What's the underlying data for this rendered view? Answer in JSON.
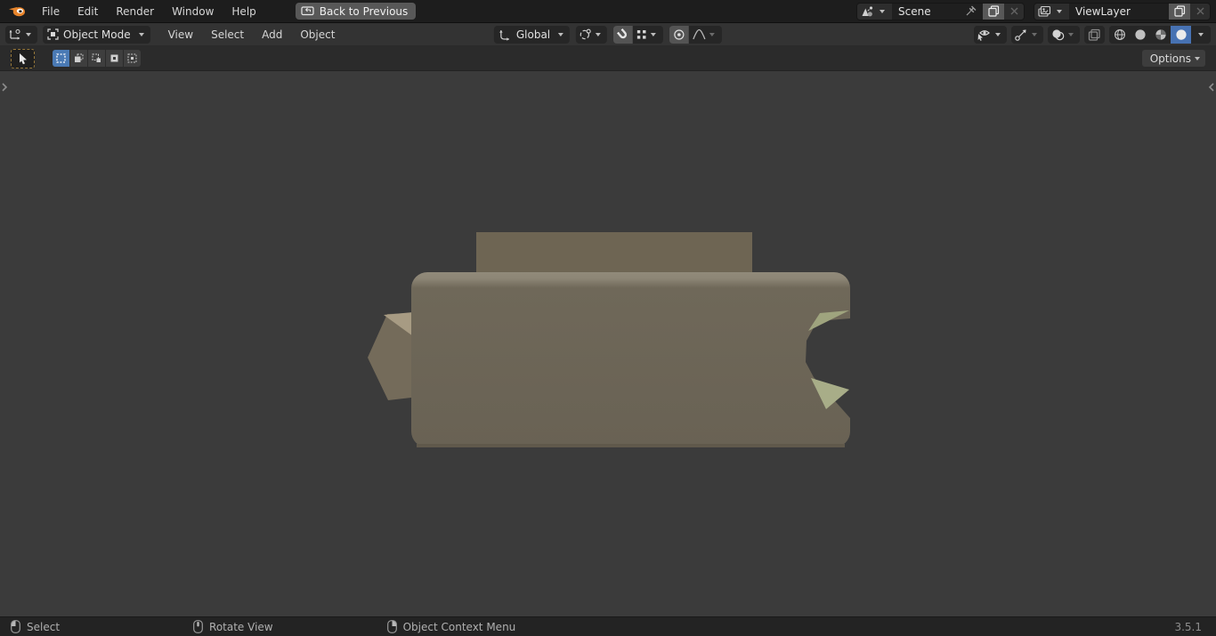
{
  "topbar": {
    "menus": [
      "File",
      "Edit",
      "Render",
      "Window",
      "Help"
    ],
    "back_button": "Back to Previous",
    "scene": {
      "value": "Scene"
    },
    "viewlayer": {
      "value": "ViewLayer"
    }
  },
  "header": {
    "mode": "Object Mode",
    "menus": [
      "View",
      "Select",
      "Add",
      "Object"
    ],
    "orientation": "Global",
    "options_button": "Options"
  },
  "statusbar": {
    "items": [
      {
        "mouse": "left-mouse-button",
        "label": "Select"
      },
      {
        "mouse": "middle-mouse-button",
        "label": "Rotate View"
      },
      {
        "mouse": "right-mouse-button",
        "label": "Object Context Menu"
      }
    ],
    "version": "3.5.1"
  },
  "colors": {
    "accent_blue": "#4772b3",
    "topbar_bg": "#1d1d1d",
    "header_bg": "#333333",
    "viewport_bg": "#3b3b3b",
    "logo_orange": "#e8852c",
    "object_body": "#6b6455",
    "object_back_panel": "#6e6553",
    "object_facet_tan": "#a79b83",
    "object_facet_green": "#a3a881",
    "tool_border_amber": "#97783a"
  }
}
